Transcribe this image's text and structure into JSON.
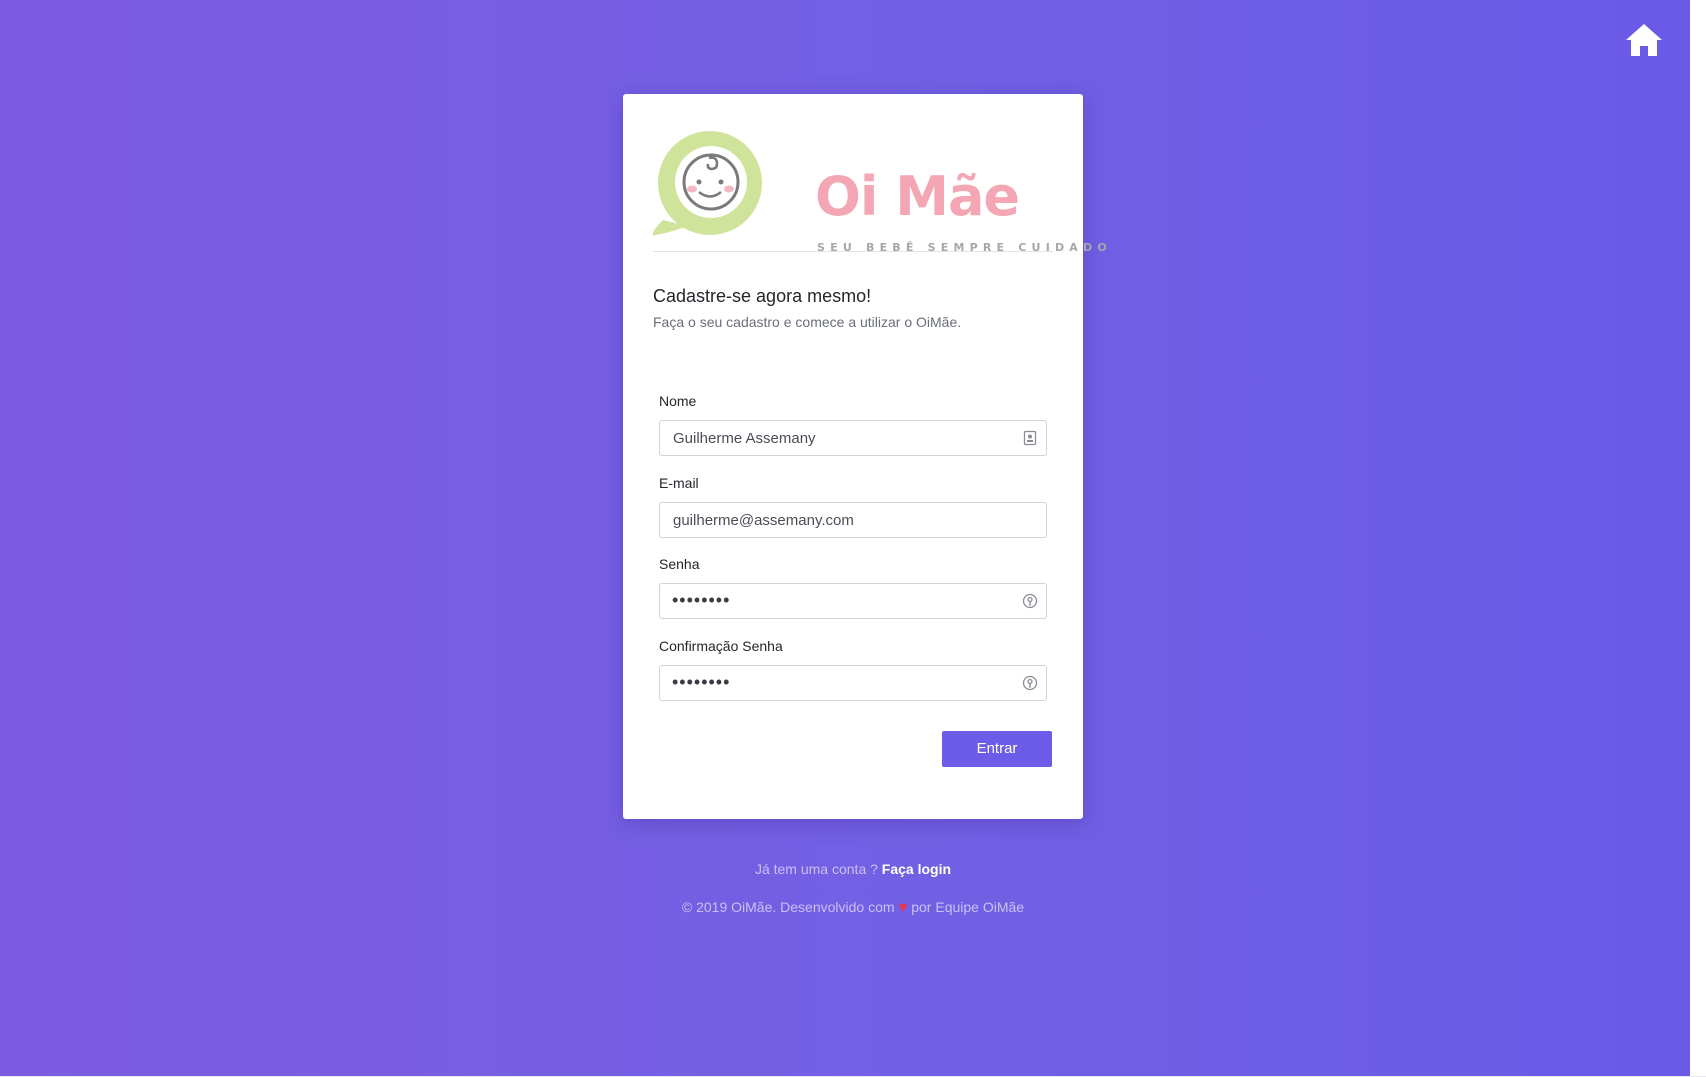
{
  "logo": {
    "title": "Oi Mãe",
    "tagline": "SEU BEBÊ SEMPRE CUIDADO"
  },
  "form": {
    "heading": "Cadastre-se agora mesmo!",
    "subheading": "Faça o seu cadastro e comece a utilizar o OiMãe.",
    "fields": [
      {
        "label": "Nome",
        "value": "Guilherme Assemany",
        "type": "text",
        "icon": "contact-card-icon"
      },
      {
        "label": "E-mail",
        "value": "guilherme@assemany.com",
        "type": "email"
      },
      {
        "label": "Senha",
        "value": "••••••••",
        "type": "password",
        "icon": "key-icon"
      },
      {
        "label": "Confirmação Senha",
        "value": "••••••••",
        "type": "password",
        "icon": "key-icon"
      }
    ],
    "submit_label": "Entrar"
  },
  "login_prompt": {
    "text": "Já tem uma conta ? ",
    "link": "Faça login"
  },
  "footer": {
    "prefix": "© 2019 OiMãe. Desenvolvido com ",
    "heart": "♥",
    "suffix": " por Equipe OiMãe"
  },
  "colors": {
    "background": "#7260e4",
    "accent": "#6c5ce7",
    "logo_pink": "#f4a6b4",
    "logo_green": "#cfe39a"
  },
  "icons": {
    "top_right": "home-icon"
  }
}
